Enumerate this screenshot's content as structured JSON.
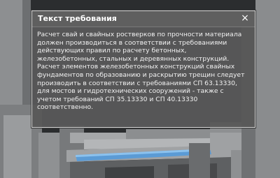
{
  "tooltip": {
    "title": "Текст требования",
    "close_glyph": "×",
    "lines": [
      "Расчет свай и свайных ростверков по прочности материала",
      "должен производиться в соответствии с требованиями",
      "действующих правил по расчету бетонных,",
      "железобетонных, стальных и деревянных конструкций.",
      "Расчет элементов железобетонных конструкций свайных",
      "фундаментов по образованию и раскрытию трещин следует",
      "производить в соответствии с требованиями СП 63.13330,",
      "для мостов и гидротехнических сооружений - также с",
      "учетом требований СП 35.13330 и СП 40.13330",
      "соответственно."
    ]
  },
  "colors": {
    "panel_background": "#585858",
    "panel_border": "#d4d4d4",
    "highlight_beam": "#5b9bd5"
  }
}
